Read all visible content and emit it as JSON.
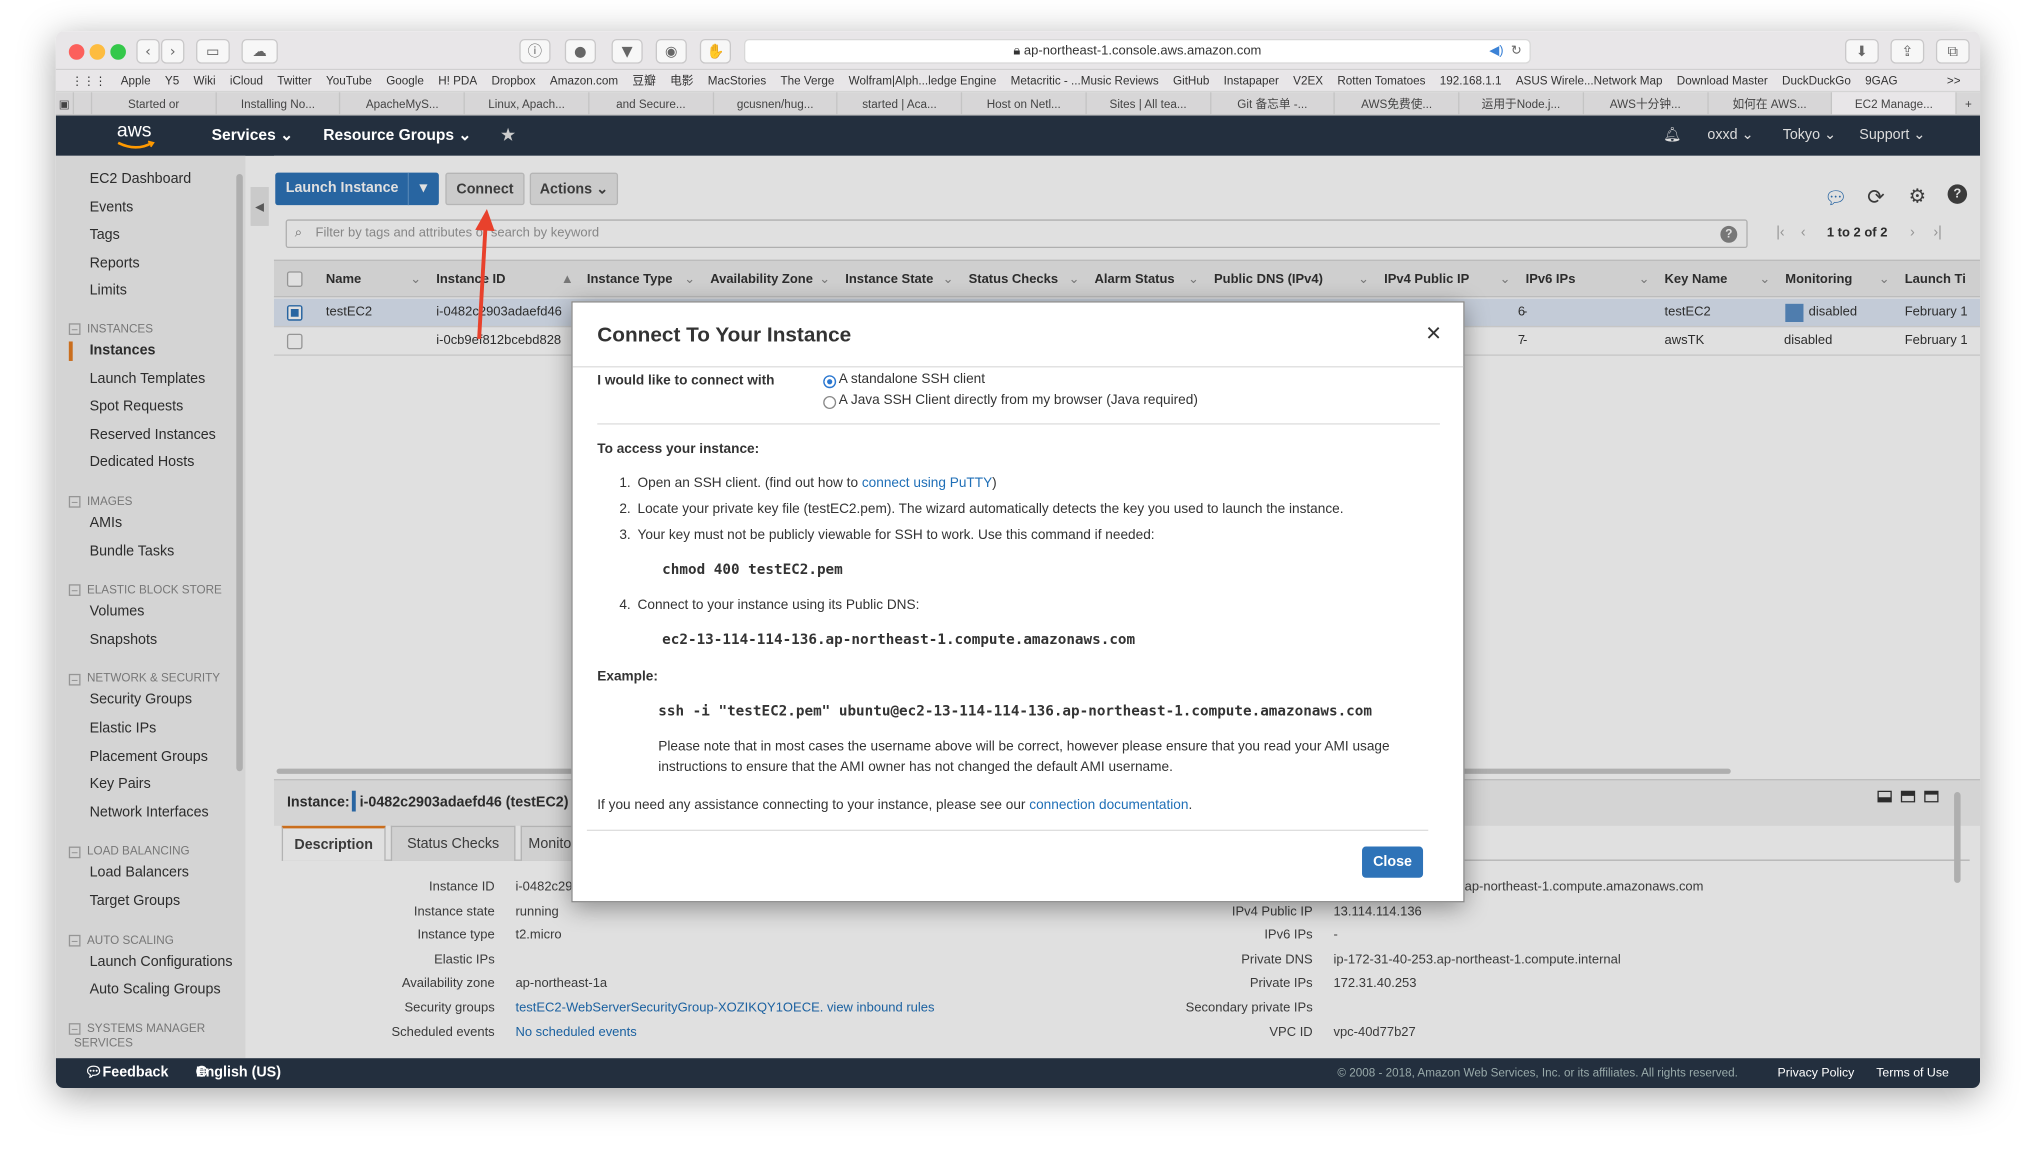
{
  "browser": {
    "url": "ap-northeast-1.console.aws.amazon.com",
    "bookmarks": [
      "Apple",
      "Y5",
      "Wiki",
      "iCloud",
      "Twitter",
      "YouTube",
      "Google",
      "H! PDA",
      "Dropbox",
      "Amazon.com",
      "豆瓣",
      "电影",
      "MacStories",
      "The Verge",
      "Wolfram|Alph...ledge Engine",
      "Metacritic - ...Music Reviews",
      "GitHub",
      "Instapaper",
      "V2EX",
      "Rotten Tomatoes",
      "192.168.1.1",
      "ASUS Wirele...Network Map",
      "Download Master",
      "DuckDuckGo",
      "9GAG"
    ],
    "bookmarks_more": ">>",
    "tabs": [
      "Started or",
      "Installing No...",
      "ApacheMyS...",
      "Linux, Apach...",
      "and Secure...",
      "gcusnen/hug...",
      "started | Aca...",
      "Host on Netl...",
      "Sites | All tea...",
      "Git 备忘单 -...",
      "AWS免费使...",
      "运用于Node.j...",
      "AWS十分钟...",
      "如何在 AWS...",
      "EC2 Manage..."
    ],
    "new_tab": "+"
  },
  "aws_nav": {
    "logo": "aws",
    "services": "Services",
    "resource_groups": "Resource Groups",
    "pin": "★",
    "bell": "bell-icon",
    "user": "oxxd",
    "region": "Tokyo",
    "support": "Support"
  },
  "sidebar": {
    "top_items": [
      "EC2 Dashboard",
      "Events",
      "Tags",
      "Reports",
      "Limits"
    ],
    "sections": [
      {
        "title": "INSTANCES",
        "items": [
          "Instances",
          "Launch Templates",
          "Spot Requests",
          "Reserved Instances",
          "Dedicated Hosts"
        ]
      },
      {
        "title": "IMAGES",
        "items": [
          "AMIs",
          "Bundle Tasks"
        ]
      },
      {
        "title": "ELASTIC BLOCK STORE",
        "items": [
          "Volumes",
          "Snapshots"
        ]
      },
      {
        "title": "NETWORK & SECURITY",
        "items": [
          "Security Groups",
          "Elastic IPs",
          "Placement Groups",
          "Key Pairs",
          "Network Interfaces"
        ]
      },
      {
        "title": "LOAD BALANCING",
        "items": [
          "Load Balancers",
          "Target Groups"
        ]
      },
      {
        "title": "AUTO SCALING",
        "items": [
          "Launch Configurations",
          "Auto Scaling Groups"
        ]
      },
      {
        "title": "SYSTEMS MANAGER SERVICES",
        "items": []
      }
    ],
    "active": "Instances"
  },
  "toolbar": {
    "launch": "Launch Instance",
    "connect": "Connect",
    "actions": "Actions",
    "filter_placeholder": "Filter by tags and attributes or search by keyword",
    "pagination": "1 to 2 of 2"
  },
  "table": {
    "columns": [
      "Name",
      "Instance ID",
      "Instance Type",
      "Availability Zone",
      "Instance State",
      "Status Checks",
      "Alarm Status",
      "Public DNS (IPv4)",
      "IPv4 Public IP",
      "IPv6 IPs",
      "Key Name",
      "Monitoring",
      "Launch Ti"
    ],
    "rows": [
      {
        "name": "testEC2",
        "id": "i-0482c2903adaefd46",
        "ipv4": "6",
        "ipv6": "-",
        "key": "testEC2",
        "monitoring": "disabled",
        "launch": "February 1",
        "selected": true
      },
      {
        "name": "",
        "id": "i-0cb9ef812bcebd828",
        "ipv4": "7",
        "ipv6": "-",
        "key": "awsTK",
        "monitoring": "disabled",
        "launch": "February 1",
        "selected": false
      }
    ]
  },
  "details": {
    "header_label": "Instance:",
    "header_value": "i-0482c2903adaefd46 (testEC2)",
    "tabs": [
      "Description",
      "Status Checks",
      "Monito"
    ],
    "left": [
      {
        "label": "Instance ID",
        "value": "i-0482c29"
      },
      {
        "label": "Instance state",
        "value": "running"
      },
      {
        "label": "Instance type",
        "value": "t2.micro"
      },
      {
        "label": "Elastic IPs",
        "value": ""
      },
      {
        "label": "Availability zone",
        "value": "ap-northeast-1a"
      },
      {
        "label": "Security groups",
        "value": "testEC2-WebServerSecurityGroup-XOZIKQY1OECE.  view inbound rules"
      },
      {
        "label": "Scheduled events",
        "value": "No scheduled events"
      }
    ],
    "right": [
      {
        "label": "",
        "value": "ap-northeast-1.compute.amazonaws.com"
      },
      {
        "label": "IPv4 Public IP",
        "value": "13.114.114.136"
      },
      {
        "label": "IPv6 IPs",
        "value": "-"
      },
      {
        "label": "Private DNS",
        "value": "ip-172-31-40-253.ap-northeast-1.compute.internal"
      },
      {
        "label": "Private IPs",
        "value": "172.31.40.253"
      },
      {
        "label": "Secondary private IPs",
        "value": ""
      },
      {
        "label": "VPC ID",
        "value": "vpc-40d77b27"
      }
    ]
  },
  "modal": {
    "title": "Connect To Your Instance",
    "close_x": "×",
    "connect_with_label": "I would like to connect with",
    "option1": "A standalone SSH client",
    "option2": "A Java SSH Client directly from my browser (Java required)",
    "access_heading": "To access your instance:",
    "step1_num": "1.",
    "step1_text": "Open an SSH client. (find out how to ",
    "step1_link": "connect using PuTTY",
    "step1_end": ")",
    "step2_num": "2.",
    "step2_text": "Locate your private key file (testEC2.pem). The wizard automatically detects the key you used to launch the instance.",
    "step3_num": "3.",
    "step3_text": "Your key must not be publicly viewable for SSH to work. Use this command if needed:",
    "chmod": "chmod 400 testEC2.pem",
    "step4_num": "4.",
    "step4_text": "Connect to your instance using its Public DNS:",
    "dns": "ec2-13-114-114-136.ap-northeast-1.compute.amazonaws.com",
    "example_heading": "Example:",
    "example_cmd": "ssh -i \"testEC2.pem\" ubuntu@ec2-13-114-114-136.ap-northeast-1.compute.amazonaws.com",
    "note_line1": "Please note that in most cases the username above will be correct, however please ensure that you read your AMI usage",
    "note_line2": "instructions to ensure that the AMI owner has not changed the default AMI username.",
    "help_text": "If you need any assistance connecting to your instance, please see our ",
    "help_link": "connection documentation",
    "help_end": ".",
    "close_button": "Close"
  },
  "footer": {
    "feedback": "Feedback",
    "language": "English (US)",
    "copyright": "© 2008 - 2018, Amazon Web Services, Inc. or its affiliates. All rights reserved.",
    "privacy": "Privacy Policy",
    "terms": "Terms of Use"
  },
  "colors": {
    "aws_nav": "#232f3e",
    "primary_button": "#2e73b8",
    "link": "#1f6fb7",
    "annotation_arrow": "#e8412c"
  }
}
